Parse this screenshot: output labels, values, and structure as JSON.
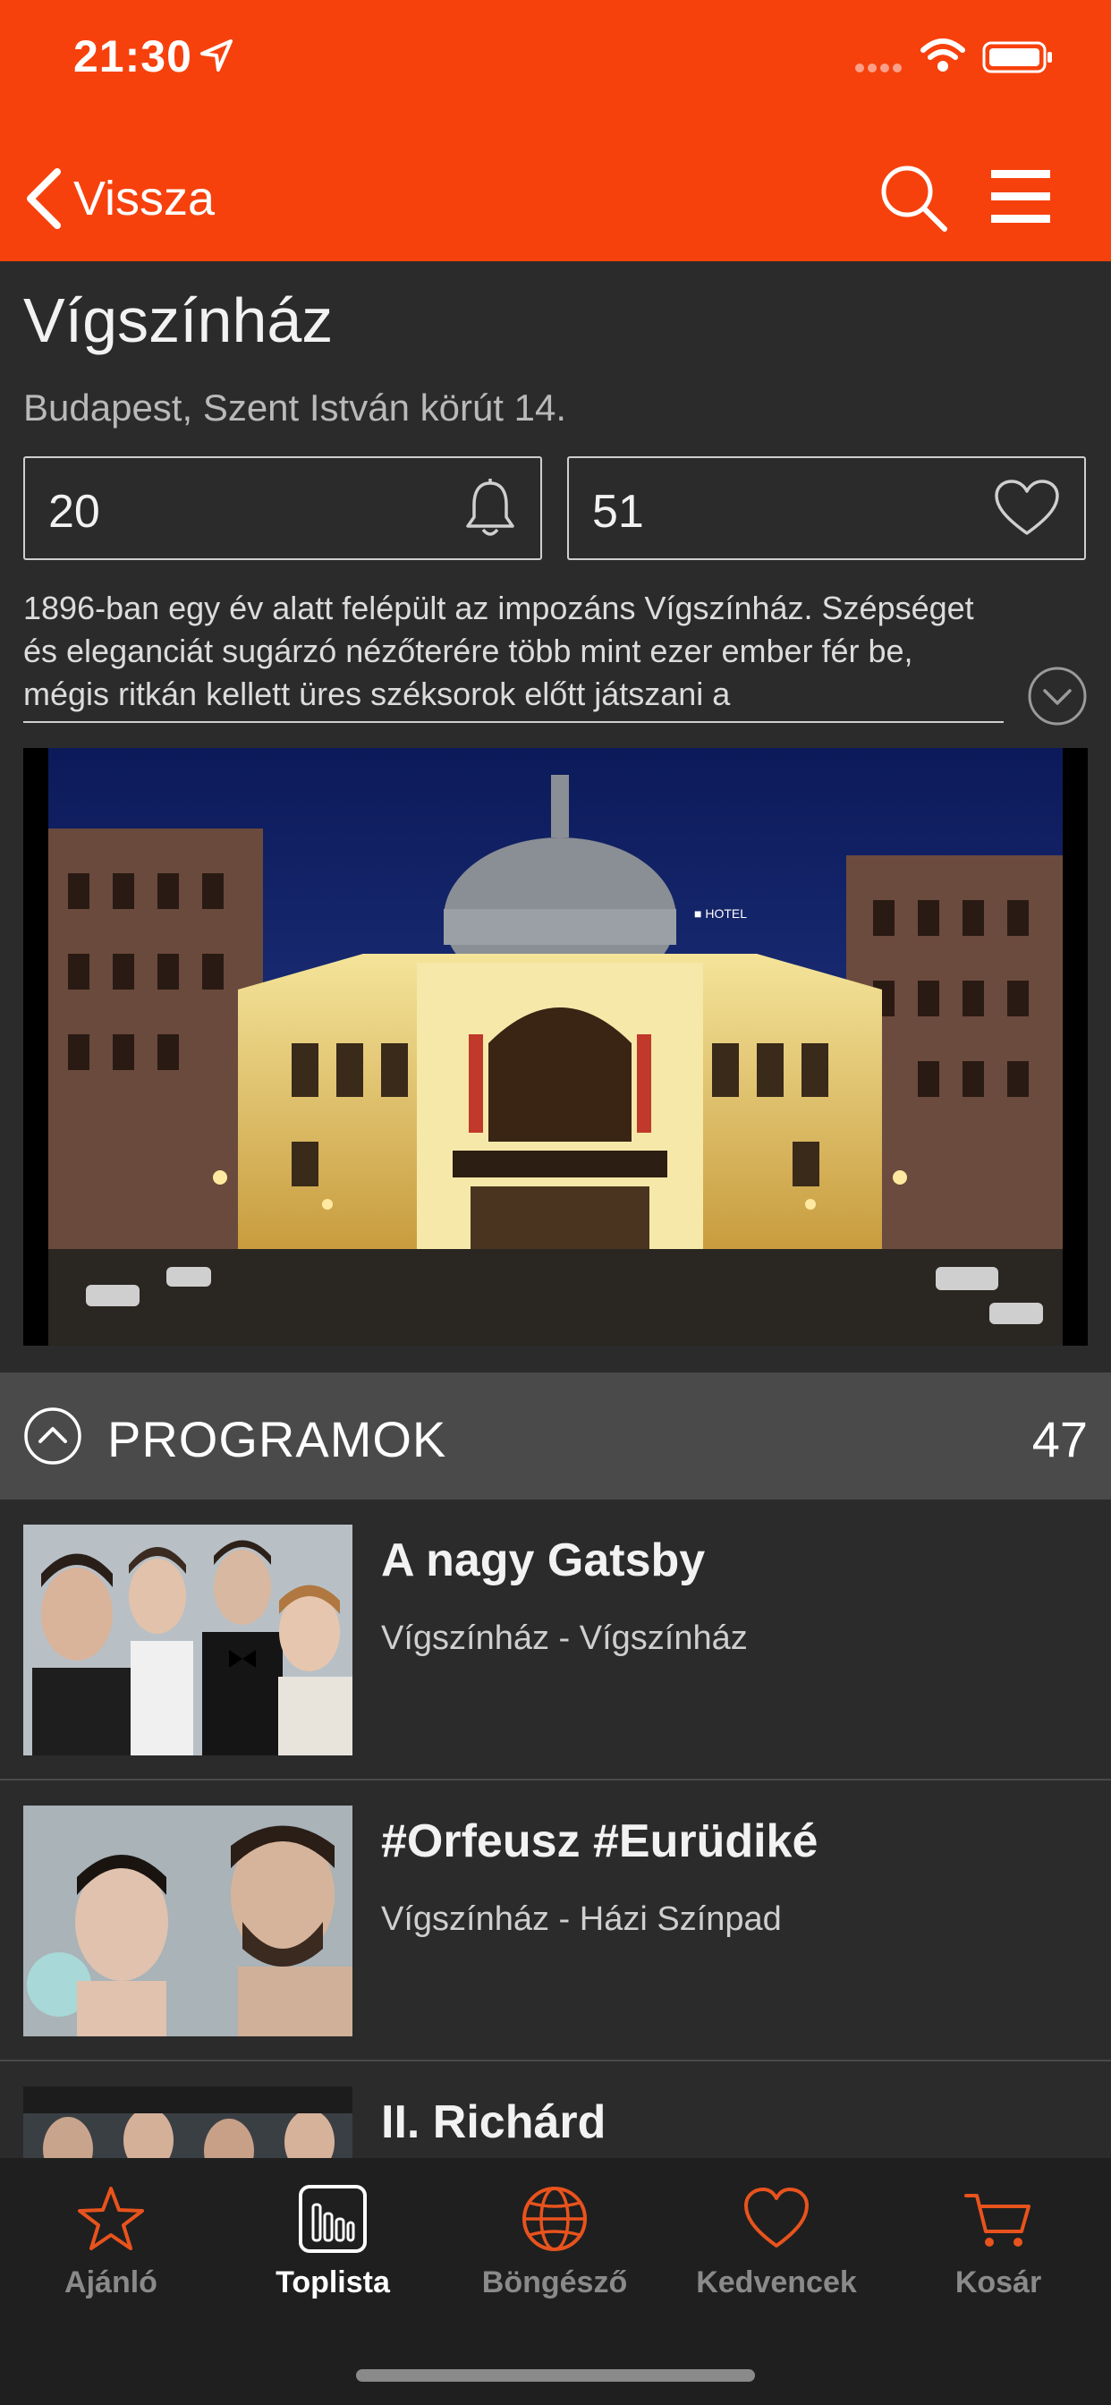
{
  "status": {
    "time": "21:30"
  },
  "nav": {
    "back_label": "Vissza"
  },
  "venue": {
    "title": "Vígszínház",
    "address": "Budapest, Szent István körút 14.",
    "alerts_count": "20",
    "favorites_count": "51",
    "description": "1896-ban egy év alatt felépült az impozáns Vígszínház. Szépséget és eleganciát sugárzó nézőterére több mint ezer ember fér be, mégis ritkán kellett üres széksorok előtt játszani a"
  },
  "programs": {
    "label": "PROGRAMOK",
    "count": "47",
    "items": [
      {
        "title": "A nagy Gatsby",
        "venue": "Vígszínház - Vígszínház"
      },
      {
        "title": "#Orfeusz #Eurüdiké",
        "venue": "Vígszínház - Házi Színpad"
      },
      {
        "title": "II. Richárd",
        "venue": ""
      }
    ]
  },
  "tabs": [
    {
      "label": "Ajánló"
    },
    {
      "label": "Toplista"
    },
    {
      "label": "Böngésző"
    },
    {
      "label": "Kedvencek"
    },
    {
      "label": "Kosár"
    }
  ],
  "colors": {
    "accent": "#f7410d",
    "background": "#2b2b2b",
    "tab_accent": "#e8531d"
  }
}
